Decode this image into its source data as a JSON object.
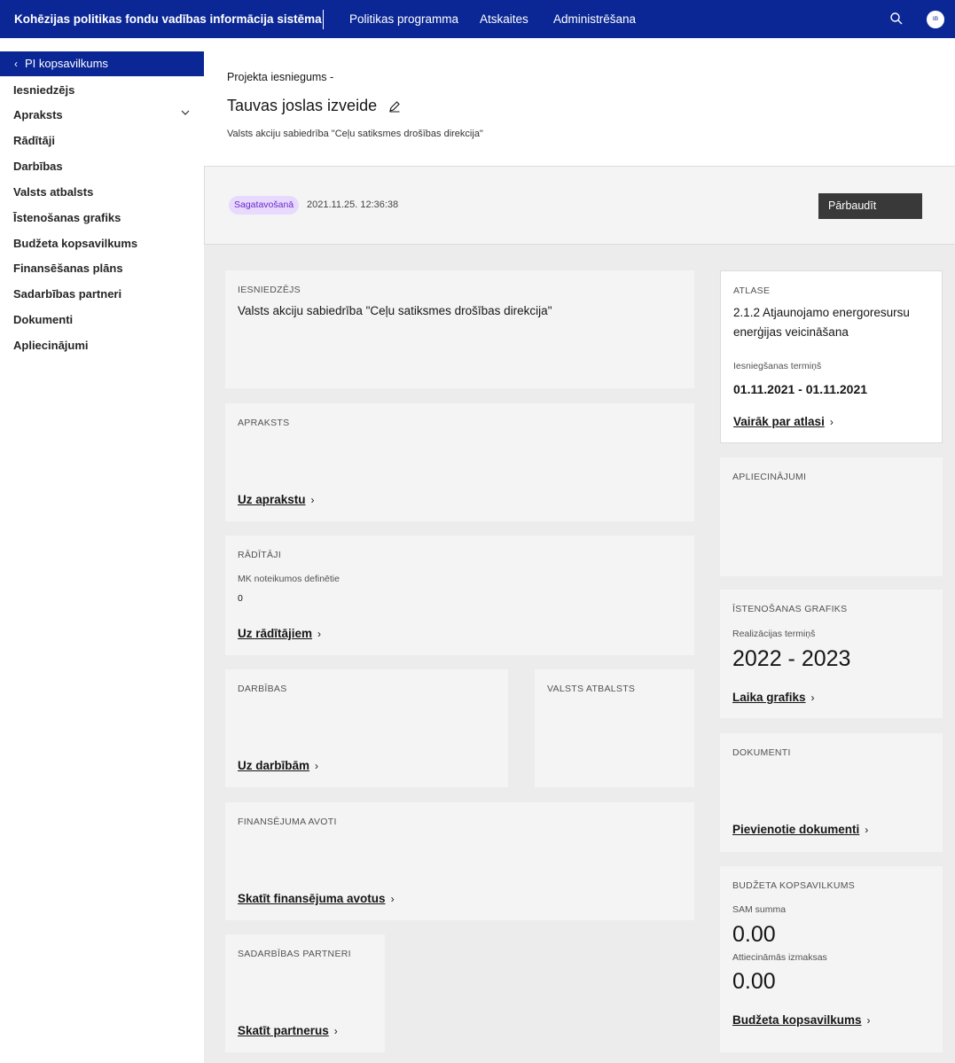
{
  "topbar": {
    "brand": "Kohēzijas politikas fondu vadības informācija sistēma",
    "nav": [
      "Politikas programma",
      "Atskaites",
      "Administrēšana"
    ],
    "avatar_initials": "IB",
    "search_icon": "search-icon"
  },
  "sidebar": {
    "active": "PI kopsavilkums",
    "items": [
      "Iesniedzējs",
      "Apraksts",
      "Rādītāji",
      "Darbības",
      "Valsts atbalsts",
      "Īstenošanas grafiks",
      "Budžeta kopsavilkums",
      "Finansēšanas plāns",
      "Sadarbības partneri",
      "Dokumenti",
      "Apliecinājumi"
    ]
  },
  "header": {
    "breadcrumb": "Projekta iesniegums -",
    "title": "Tauvas joslas izveide",
    "subtitle": "Valsts akciju sabiedrība \"Ceļu satiksmes drošības direkcija\""
  },
  "status": {
    "badge": "Sagatavošanā",
    "timestamp": "2021.11.25. 12:36:38",
    "check_button": "Pārbaudīt",
    "badge_color": "#e8daff"
  },
  "cards": {
    "applicant": {
      "label": "IESNIEDZĒJS",
      "value": "Valsts akciju sabiedrība \"Ceļu satiksmes drošības direkcija\""
    },
    "description": {
      "label": "APRAKSTS",
      "link": "Uz aprakstu"
    },
    "indicators": {
      "label": "RĀDĪTĀJI",
      "sub_label": "MK noteikumos definētie",
      "sub_value": "0",
      "link": "Uz rādītājiem"
    },
    "activities": {
      "label": "DARBĪBAS",
      "link": "Uz darbībām"
    },
    "state_aid": {
      "label": "VALSTS ATBALSTS"
    },
    "funding": {
      "label": "FINANSĒJUMA AVOTI",
      "link": "Skatīt finansējuma avotus"
    },
    "partners": {
      "label": "SADARBĪBAS PARTNERI",
      "link": "Skatīt partnerus"
    },
    "selection": {
      "label": "ATLASE",
      "name": "2.1.2 Atjaunojamo energoresursu enerģijas veicināšana",
      "deadline_label": "Iesniegšanas termiņš",
      "deadline": "01.11.2021 - 01.11.2021",
      "link": "Vairāk par atlasi"
    },
    "confirmations": {
      "label": "APLIECINĀJUMI"
    },
    "schedule": {
      "label": "ĪSTENOŠANAS GRAFIKS",
      "sub_label": "Realizācijas termiņš",
      "years": "2022 - 2023",
      "link": "Laika grafiks"
    },
    "documents": {
      "label": "DOKUMENTI",
      "link": "Pievienotie dokumenti"
    },
    "budget": {
      "label": "BUDŽETA KOPSAVILKUMS",
      "sam_label": "SAM summa",
      "sam_value": "0.00",
      "eligible_label": "Attiecināmās izmaksas",
      "eligible_value": "0.00",
      "link": "Budžeta kopsavilkums"
    }
  },
  "colors": {
    "brand": "#0b2795",
    "button": "#393939"
  }
}
